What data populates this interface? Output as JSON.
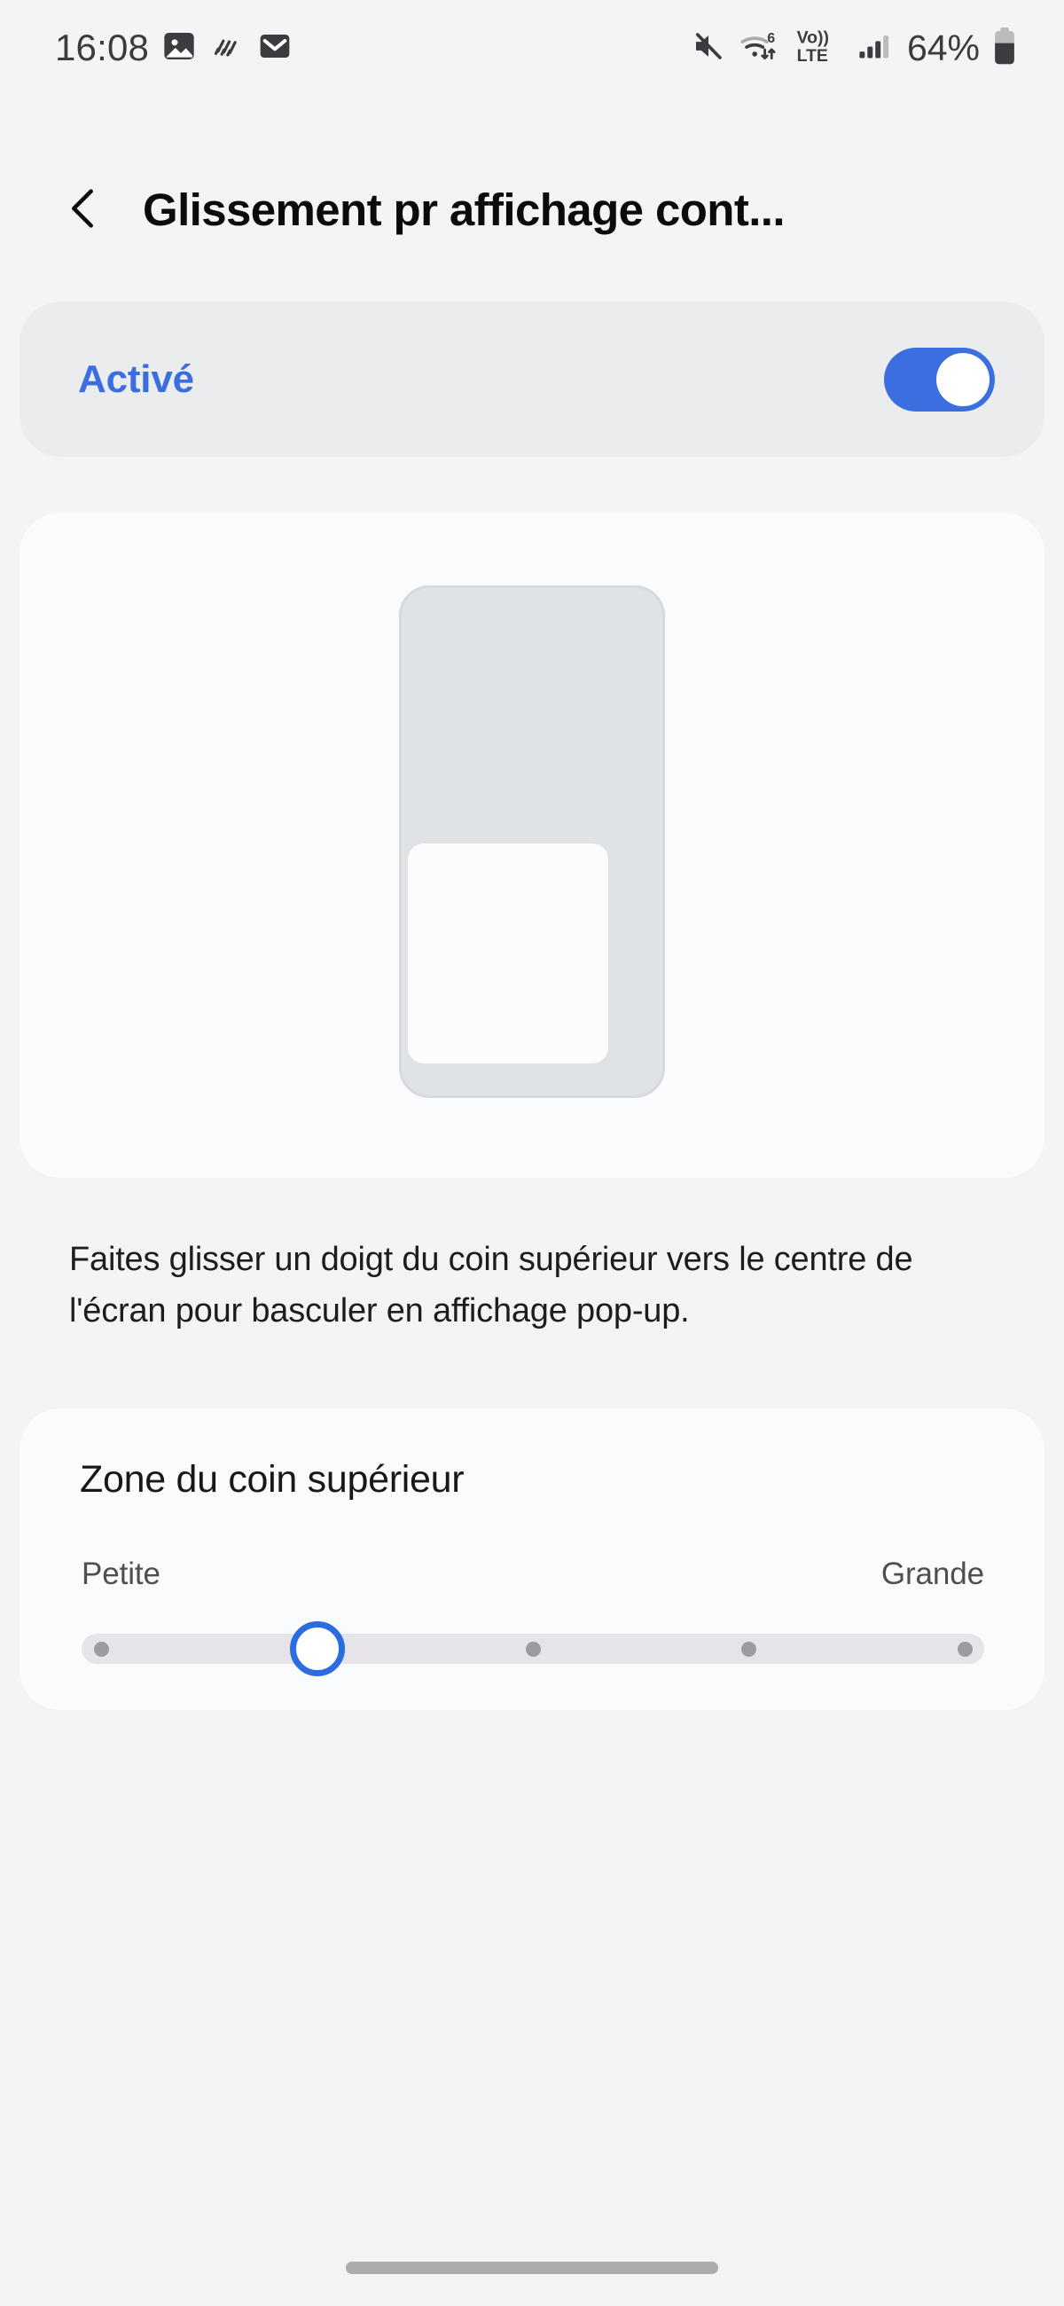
{
  "status_bar": {
    "time": "16:08",
    "battery_percent": "64%",
    "battery_level": 64,
    "left_icons": [
      {
        "name": "image-icon",
        "label": "Image"
      },
      {
        "name": "rain-lines-icon",
        "label": "Weather"
      },
      {
        "name": "mail-icon",
        "label": "Mail"
      }
    ],
    "right_icons": [
      {
        "name": "mute-icon",
        "label": "Sound off"
      },
      {
        "name": "wifi-6-icon",
        "label": "Wi-Fi 6",
        "badge": "6"
      },
      {
        "name": "volte-icon",
        "label": "Vo)) LTE",
        "line1": "Vo))",
        "line2": "LTE"
      },
      {
        "name": "cellular-signal-icon",
        "label": "Signal",
        "bars_filled": 3,
        "bars_total": 4
      },
      {
        "name": "battery-icon",
        "label": "Battery"
      }
    ]
  },
  "header": {
    "back_icon": "chevron-left-icon",
    "title": "Glissement pr affichage cont..."
  },
  "master_switch": {
    "label": "Activé",
    "enabled": true,
    "accent_color": "#3b6fe0"
  },
  "illustration": {
    "name": "popup-view-phone-illustration",
    "device_color": "#dfe3e5",
    "popup_color": "#fbfcfb"
  },
  "description": {
    "text": "Faites glisser un doigt du coin supérieur vers le centre de l'écran pour basculer en affichage pop-up."
  },
  "corner_area": {
    "heading": "Zone du coin supérieur",
    "min_label": "Petite",
    "max_label": "Grande",
    "steps": 5,
    "value_index": 1,
    "track_color": "#e6e4e9",
    "tick_color": "#9c9ca0",
    "thumb_border_color": "#2b6ce0"
  },
  "navigation": {
    "gesture_bar": "home-gesture-bar"
  }
}
